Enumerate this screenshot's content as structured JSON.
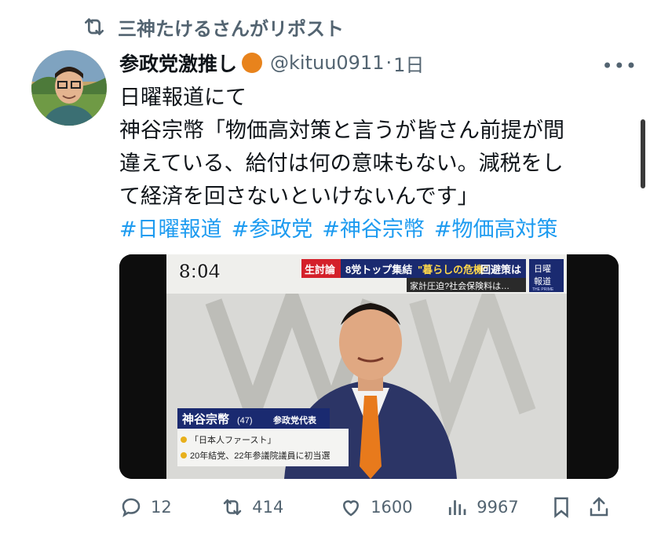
{
  "repost": {
    "text": "三神たけるさんがリポスト",
    "icon": "repost-icon"
  },
  "tweet": {
    "author_name": "参政党激推し",
    "handle": "@kituu0911",
    "dot": "·",
    "time": "1日",
    "more_icon": "more-icon",
    "lines": [
      "日曜報道にて",
      "神谷宗幣「物価高対策と言うが皆さん前提が間",
      "違えている、給付は何の意味もない。減税をし",
      "て経済を回さないといけないんです」"
    ],
    "hashtags": [
      "#日曜報道",
      "#参政党",
      "#神谷宗幣",
      "#物価高対策"
    ]
  },
  "media": {
    "time": "8:04",
    "banner_tag": "生討論",
    "banner_text": "8党トップ集結",
    "banner_emph": "\"暮らしの危機\"",
    "banner_tail": "回避策は",
    "sub_banner": "家計圧迫?社会保険料は…",
    "logo_top": "日曜",
    "logo_bottom": "報道",
    "logo_small": "THE PRIME",
    "name_caption": "神谷宗幣",
    "age": "(47)",
    "role": "参政党代表",
    "bullet1": "「日本人ファースト」",
    "bullet2": "20年結党、22年参議院議員に初当選"
  },
  "actions": {
    "replies": "12",
    "reposts": "414",
    "likes": "1600",
    "views": "9967"
  },
  "colors": {
    "accent": "#1d9bf0",
    "muted": "#536471",
    "badge": "#e8831c"
  }
}
